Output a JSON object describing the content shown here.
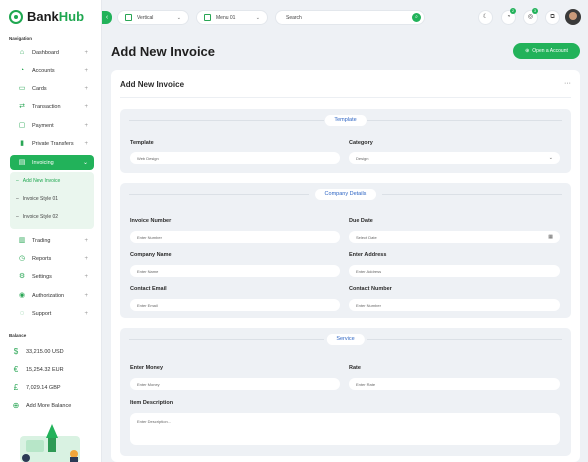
{
  "brand": {
    "name_a": "Bank",
    "name_b": "Hub"
  },
  "sidebar": {
    "nav_label": "Navigation",
    "items": [
      {
        "label": "Dashboard"
      },
      {
        "label": "Accounts"
      },
      {
        "label": "Cards"
      },
      {
        "label": "Transaction"
      },
      {
        "label": "Payment"
      },
      {
        "label": "Private Transfers"
      },
      {
        "label": "Invoicing"
      },
      {
        "label": "Trading"
      },
      {
        "label": "Reports"
      },
      {
        "label": "Settings"
      },
      {
        "label": "Authorization"
      },
      {
        "label": "Support"
      }
    ],
    "submenu": [
      {
        "label": "Add New Invoice"
      },
      {
        "label": "Invoice Style 01"
      },
      {
        "label": "Invoice Style 02"
      }
    ],
    "balance_label": "Balance",
    "balances": [
      {
        "label": "33,215.00 USD"
      },
      {
        "label": "15,254.32 EUR"
      },
      {
        "label": "7,029.14 GBP"
      },
      {
        "label": "Add More Balance"
      }
    ]
  },
  "topbar": {
    "layout_select": "Vertical",
    "menu_select": "Menu 01",
    "search_placeholder": "Search",
    "notif_badges": [
      "2",
      "3"
    ]
  },
  "page": {
    "title": "Add New Invoice",
    "open_account_label": "Open a Account",
    "card_title": "Add New Invoice",
    "more": "···"
  },
  "template_section": {
    "title": "Template",
    "template_label": "Template",
    "template_value": "Web Design",
    "category_label": "Category",
    "category_value": "Design"
  },
  "company_section": {
    "title": "Company Details",
    "invoice_number_label": "Invoice Number",
    "invoice_number_placeholder": "Enter Number",
    "due_date_label": "Due Date",
    "due_date_placeholder": "Select Date",
    "company_name_label": "Company Name",
    "company_name_placeholder": "Enter Name",
    "address_label": "Enter Address",
    "address_placeholder": "Enter Address",
    "email_label": "Contact Email",
    "email_placeholder": "Enter Email",
    "contact_number_label": "Contact Number",
    "contact_number_placeholder": "Enter Number"
  },
  "service_section": {
    "title": "Service",
    "money_label": "Enter Money",
    "money_placeholder": "Enter Money",
    "rate_label": "Rate",
    "rate_placeholder": "Enter Rate",
    "desc_label": "Item Description",
    "desc_placeholder": "Enter Description..."
  },
  "colors": {
    "accent": "#22b25a",
    "section_title": "#2f66c4"
  }
}
